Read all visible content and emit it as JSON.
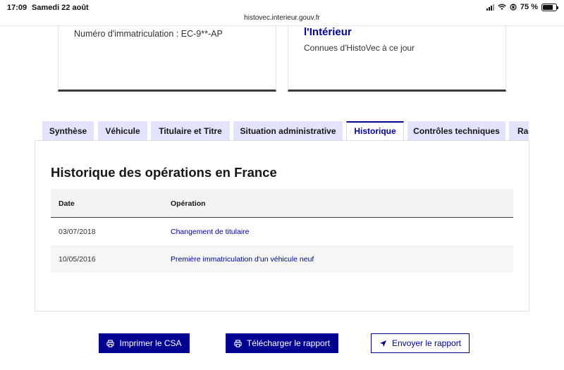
{
  "statusbar": {
    "time": "17:09",
    "date": "Samedi 22 août",
    "battery": "75 %"
  },
  "url": "histovec.interieur.gouv.fr",
  "cards": {
    "left": {
      "plate_text": "Numéro d'immatriculation : EC-9**-AP"
    },
    "right": {
      "heading": "l'Intérieur",
      "subtitle": "Connues d'HistoVec à ce jour"
    }
  },
  "tabs": [
    {
      "label": "Synthèse"
    },
    {
      "label": "Véhicule"
    },
    {
      "label": "Titulaire et Titre"
    },
    {
      "label": "Situation administrative"
    },
    {
      "label": "Historique"
    },
    {
      "label": "Contrôles techniques"
    },
    {
      "label": "Rapport"
    }
  ],
  "active_tab": "Historique",
  "panel": {
    "title": "Historique des opérations en France",
    "columns": [
      "Date",
      "Opération"
    ],
    "rows": [
      {
        "date": "03/07/2018",
        "operation": "Changement de titulaire"
      },
      {
        "date": "10/05/2016",
        "operation": "Première immatriculation d'un véhicule neuf"
      }
    ]
  },
  "actions": {
    "print": "Imprimer le CSA",
    "download": "Télécharger le rapport",
    "send": "Envoyer le rapport"
  },
  "colors": {
    "primary": "#000091",
    "tab_bg": "#e3e3fd",
    "row_alt": "#f6f6f6"
  }
}
